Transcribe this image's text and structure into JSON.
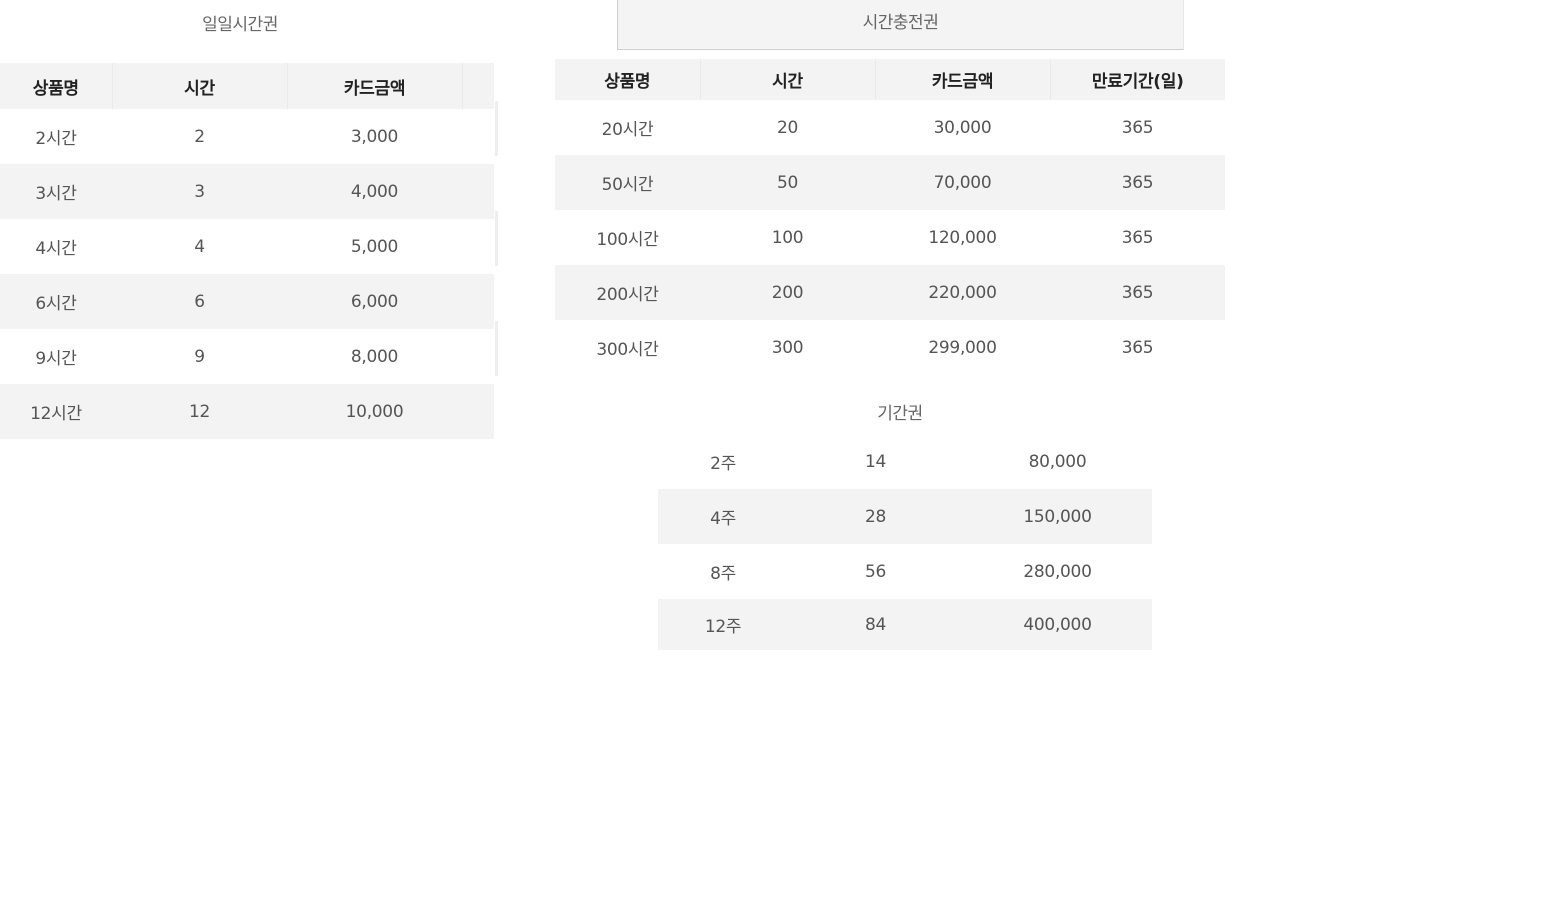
{
  "daily": {
    "title": "일일시간권",
    "headers": [
      "상품명",
      "시간",
      "카드금액"
    ],
    "rows": [
      [
        "2시간",
        "2",
        "3,000"
      ],
      [
        "3시간",
        "3",
        "4,000"
      ],
      [
        "4시간",
        "4",
        "5,000"
      ],
      [
        "6시간",
        "6",
        "6,000"
      ],
      [
        "9시간",
        "9",
        "8,000"
      ],
      [
        "12시간",
        "12",
        "10,000"
      ]
    ]
  },
  "charge": {
    "title": "시간충전권",
    "headers": [
      "상품명",
      "시간",
      "카드금액",
      "만료기간(일)"
    ],
    "rows": [
      [
        "20시간",
        "20",
        "30,000",
        "365"
      ],
      [
        "50시간",
        "50",
        "70,000",
        "365"
      ],
      [
        "100시간",
        "100",
        "120,000",
        "365"
      ],
      [
        "200시간",
        "200",
        "220,000",
        "365"
      ],
      [
        "300시간",
        "300",
        "299,000",
        "365"
      ]
    ]
  },
  "period": {
    "title": "기간권",
    "rows": [
      [
        "2주",
        "14",
        "80,000"
      ],
      [
        "4주",
        "28",
        "150,000"
      ],
      [
        "8주",
        "56",
        "280,000"
      ],
      [
        "12주",
        "84",
        "400,000"
      ]
    ]
  }
}
